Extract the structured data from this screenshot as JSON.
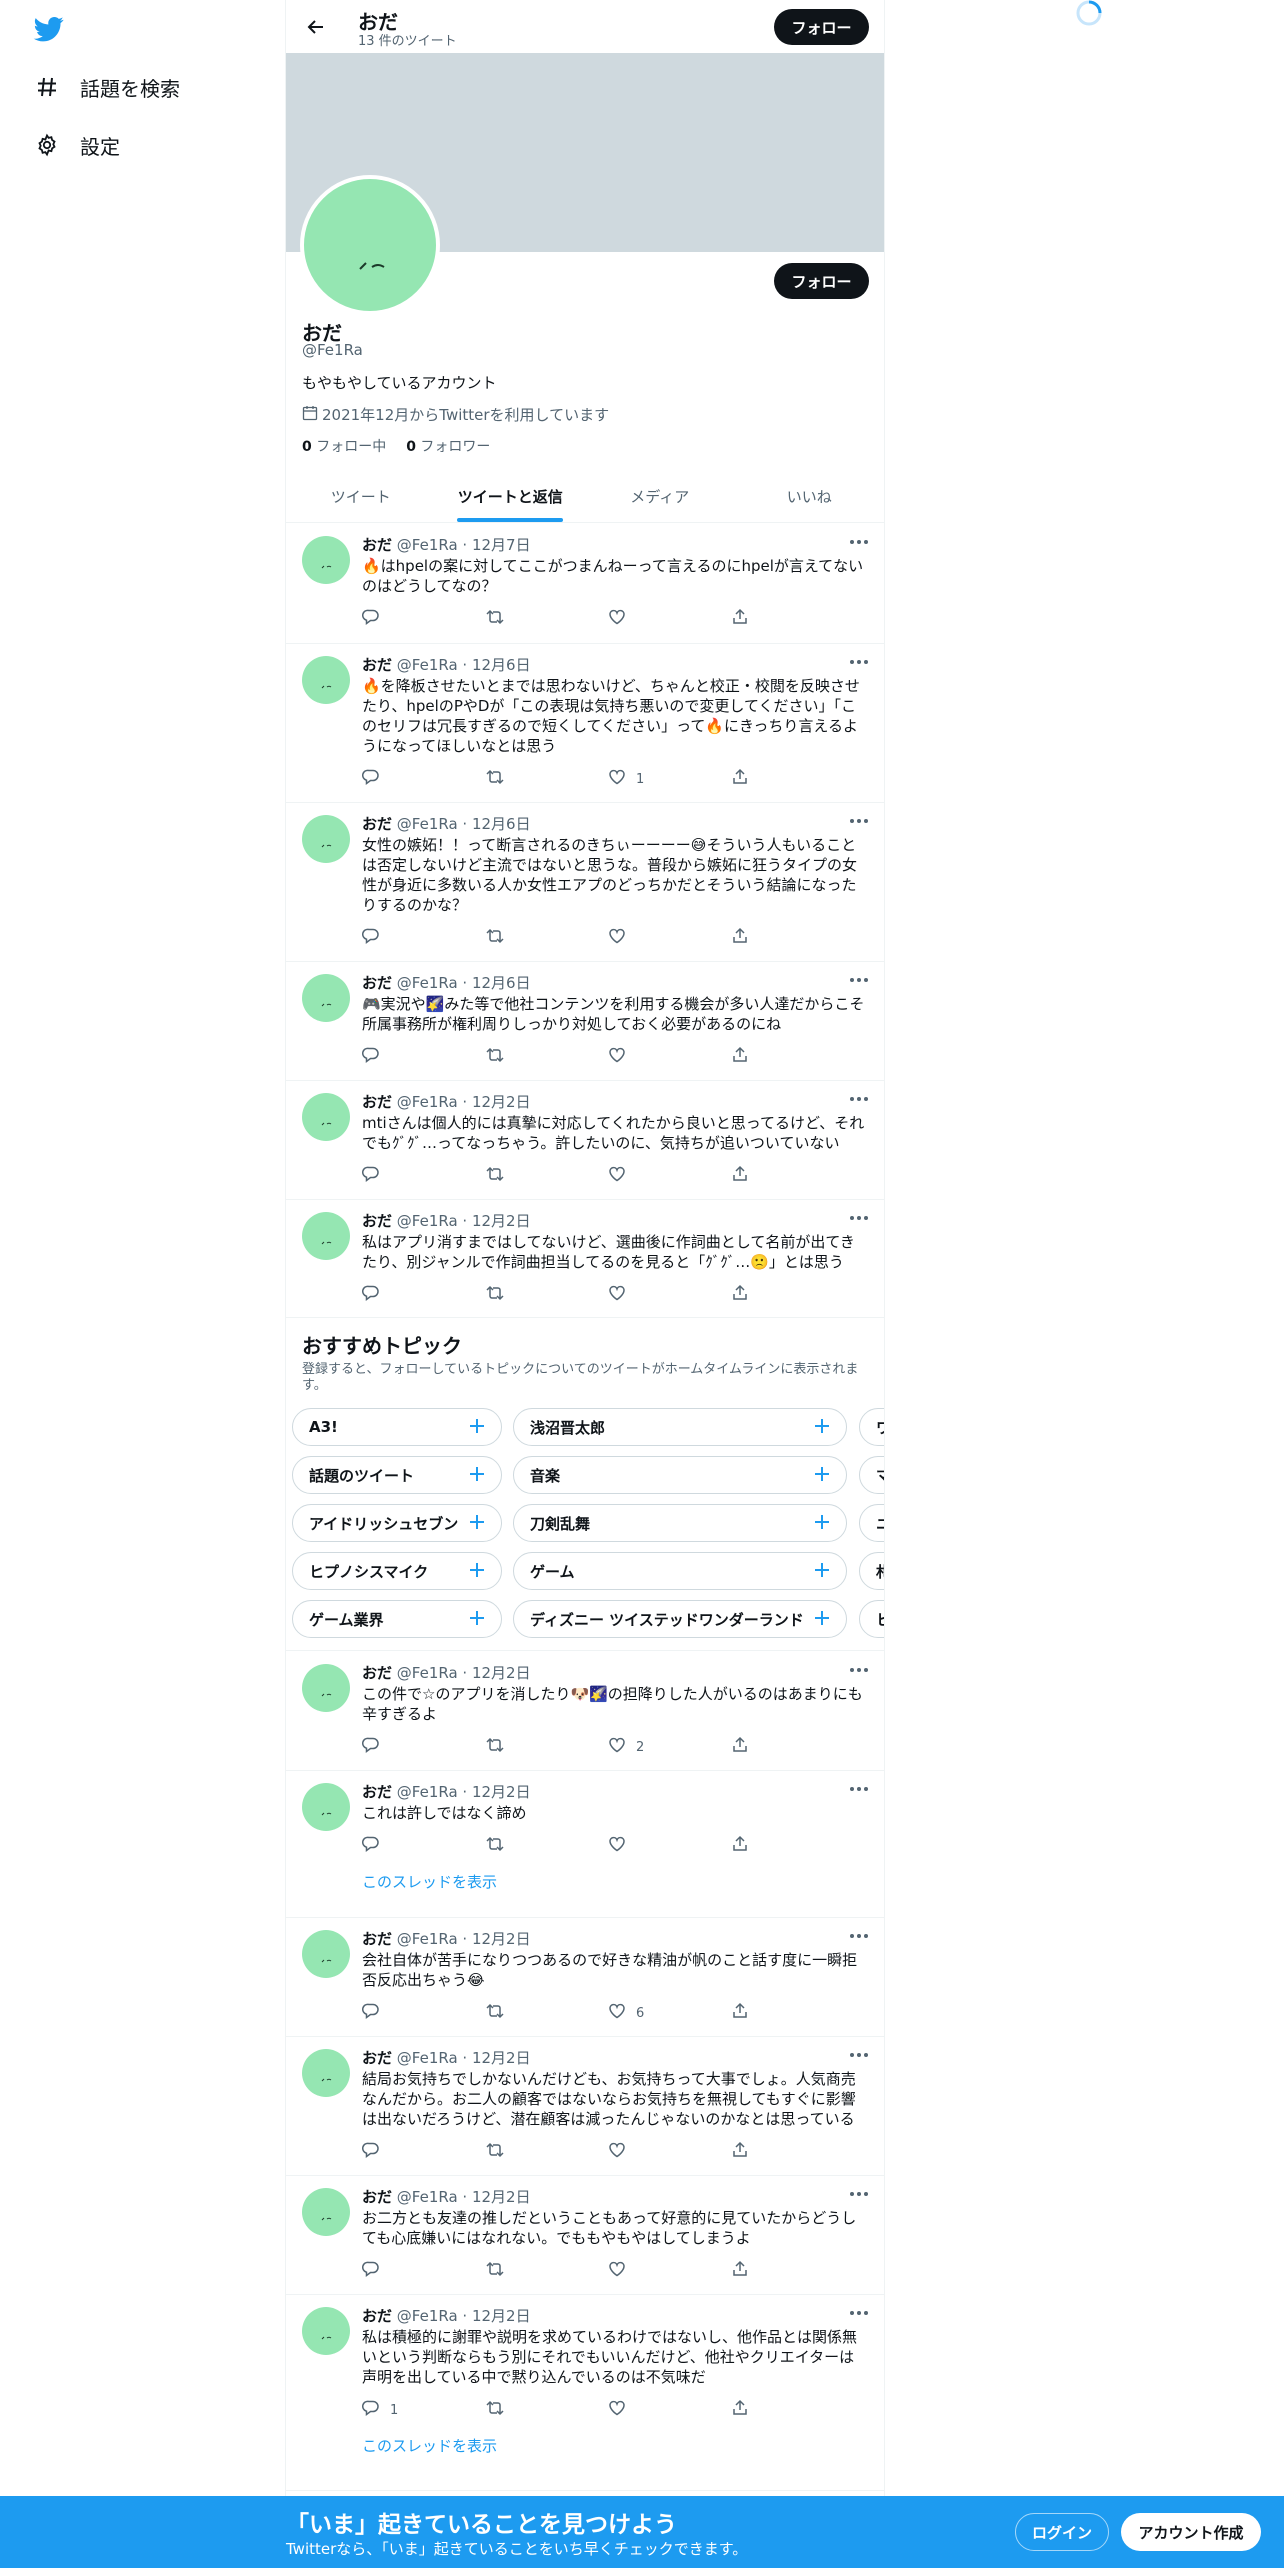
{
  "nav": {
    "logo_icon": "twitter-bird-icon",
    "items": [
      {
        "label": "話題を検索",
        "icon": "hashtag-icon"
      },
      {
        "label": "設定",
        "icon": "gear-icon"
      }
    ]
  },
  "header": {
    "title": "おだ",
    "subtitle": "13 件のツイート",
    "follow_label": "フォロー"
  },
  "profile": {
    "name": "おだ",
    "handle": "@Fe1Ra",
    "bio": "もやもやしているアカウント",
    "joined": "2021年12月からTwitterを利用しています",
    "following_count": "0",
    "following_label": "フォロー中",
    "followers_count": "0",
    "followers_label": "フォロワー",
    "follow_label": "フォロー",
    "avatar_color": "#95e6b2",
    "banner_color": "#cfd9de"
  },
  "tabs": [
    {
      "label": "ツイート"
    },
    {
      "label": "ツイートと返信"
    },
    {
      "label": "メディア"
    },
    {
      "label": "いいね"
    }
  ],
  "tweets": [
    {
      "name": "おだ",
      "meta": "@Fe1Ra · 12月7日",
      "text": "🔥はhpelの案に対してここがつまんねーって言えるのにhpelが言えてないのはどうしてなの？",
      "likes": ""
    },
    {
      "name": "おだ",
      "meta": "@Fe1Ra · 12月6日",
      "text": "🔥を降板させたいとまでは思わないけど、ちゃんと校正・校閲を反映させたり、hpelのPやDが「この表現は気持ち悪いので変更してください」「このセリフは冗長すぎるので短くしてください」って🔥にきっちり言えるようになってほしいなとは思う",
      "likes": "1"
    },
    {
      "name": "おだ",
      "meta": "@Fe1Ra · 12月6日",
      "text": "女性の嫉妬！！って断言されるのきちぃーーーー😅そういう人もいることは否定しないけど主流ではないと思うな。普段から嫉妬に狂うタイプの女性が身近に多数いる人か女性エアプのどっちかだとそういう結論になったりするのかな？",
      "likes": ""
    },
    {
      "name": "おだ",
      "meta": "@Fe1Ra · 12月6日",
      "text": "🎮実況や🌠みた等で他社コンテンツを利用する機会が多い人達だからこそ所属事務所が権利周りしっかり対処しておく必要があるのにね",
      "likes": ""
    },
    {
      "name": "おだ",
      "meta": "@Fe1Ra · 12月2日",
      "text": "mtiさんは個人的には真摯に対応してくれたから良いと思ってるけど、それでもｸﾞｸﾞ…ってなっちゃう。許したいのに、気持ちが追いついていない",
      "likes": ""
    },
    {
      "name": "おだ",
      "meta": "@Fe1Ra · 12月2日",
      "text": "私はアプリ消すまではしてないけど、選曲後に作詞曲として名前が出てきたり、別ジャンルで作詞曲担当してるのを見ると「ｸﾞｸﾞ…🙁」とは思う",
      "likes": ""
    },
    {
      "name": "おだ",
      "meta": "@Fe1Ra · 12月2日",
      "text": "この件で☆のアプリを消したり🐶🌠の担降りした人がいるのはあまりにも辛すぎるよ",
      "likes": "2"
    },
    {
      "name": "おだ",
      "meta": "@Fe1Ra · 12月2日",
      "text": "これは許しではなく諦め",
      "likes": "",
      "thread": "このスレッドを表示"
    },
    {
      "name": "おだ",
      "meta": "@Fe1Ra · 12月2日",
      "text": "会社自体が苦手になりつつあるので好きな精油が帆のこと話す度に一瞬拒否反応出ちゃう😂",
      "likes": "6"
    },
    {
      "name": "おだ",
      "meta": "@Fe1Ra · 12月2日",
      "text": "結局お気持ちでしかないんだけども、お気持ちって大事でしょ。人気商売なんだから。お二人の顧客ではないならお気持ちを無視してもすぐに影響は出ないだろうけど、潜在顧客は減ったんじゃないのかなとは思っている",
      "likes": ""
    },
    {
      "name": "おだ",
      "meta": "@Fe1Ra · 12月2日",
      "text": "お二方とも友達の推しだということもあって好意的に見ていたからどうしても心底嫌いにはなれない。でももやもやはしてしまうよ",
      "likes": ""
    },
    {
      "name": "おだ",
      "meta": "@Fe1Ra · 12月2日",
      "text": "私は積極的に謝罪や説明を求めているわけではないし、他作品とは関係無いという判断ならもう別にそれでもいいんだけど、他社やクリエイターは声明を出している中で黙り込んでいるのは不気味だ",
      "likes": "",
      "replies": "1",
      "thread": "このスレッドを表示"
    }
  ],
  "topics": {
    "title": "おすすめトピック",
    "description": "登録すると、フォローしているトピックについてのツイートがホームタイムラインに表示されます。",
    "rows": [
      [
        "A3!",
        "浅沼晋太郎",
        "ワ"
      ],
      [
        "話題のツイート",
        "音楽",
        "マ"
      ],
      [
        "アイドリッシュセブン",
        "刀剣乱舞",
        "ニ"
      ],
      [
        "ヒプノシスマイク",
        "ゲーム",
        "札"
      ],
      [
        "ゲーム業界",
        "ディズニー ツイステッドワンダーランド",
        "ヒ"
      ]
    ]
  },
  "bottom": {
    "title": "「いま」起きていることを見つけよう",
    "subtitle": "Twitterなら、「いま」起きていることをいち早くチェックできます。",
    "login": "ログイン",
    "signup": "アカウント作成"
  },
  "colors": {
    "accent": "#1d9bf0",
    "dark": "#0f1419",
    "muted": "#536471"
  }
}
